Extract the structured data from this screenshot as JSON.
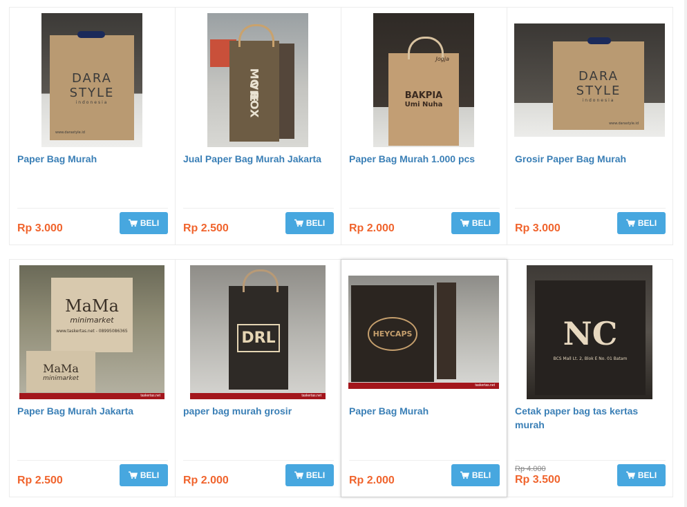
{
  "buy_label": "BELI",
  "colors": {
    "title": "#3a7fb6",
    "price": "#f0642d",
    "button": "#47a7df"
  },
  "products": [
    {
      "title": "Paper Bag Murah",
      "price": "Rp 3.000",
      "image_text": [
        "DARA",
        "STYLE"
      ],
      "image_subtext": "indonesia",
      "footer_text": "www.darastyle.id"
    },
    {
      "title": "Jual Paper Bag Murah Jakarta",
      "price": "Rp 2.500",
      "image_text": [
        "MO",
        "VIE",
        "BOX"
      ],
      "image_subtext": "",
      "footer_text": ""
    },
    {
      "title": "Paper Bag Murah 1.000 pcs",
      "price": "Rp 2.000",
      "image_text": [
        "BAKPIA",
        "Umi Nuha"
      ],
      "image_subtext": "Jogja",
      "footer_text": ""
    },
    {
      "title": "Grosir Paper Bag Murah",
      "price": "Rp 3.000",
      "image_text": [
        "DARA",
        "STYLE"
      ],
      "image_subtext": "indonesia",
      "footer_text": "www.darastyle.id"
    },
    {
      "title": "Paper Bag Murah Jakarta",
      "price": "Rp 2.500",
      "image_text": [
        "MaMa",
        "minimarket"
      ],
      "image_subtext": "www.taskertas.net - 08995086365",
      "footer_text": "taskertas.net"
    },
    {
      "title": "paper bag murah grosir",
      "price": "Rp 2.000",
      "image_text": [
        "DRL"
      ],
      "image_subtext": "",
      "footer_text": "taskertas.net"
    },
    {
      "title": "Paper Bag Murah",
      "price": "Rp 2.000",
      "image_text": [
        "HEYCAPS"
      ],
      "image_subtext": "",
      "footer_text": "taskertas.net"
    },
    {
      "title": "Cetak paper bag tas kertas murah",
      "old_price": "Rp 4.000",
      "price": "Rp 3.500",
      "image_text": [
        "NC"
      ],
      "image_subtext": "BCS Mall Lt. 2, Blok E No. 01 Batam",
      "footer_text": ""
    }
  ]
}
